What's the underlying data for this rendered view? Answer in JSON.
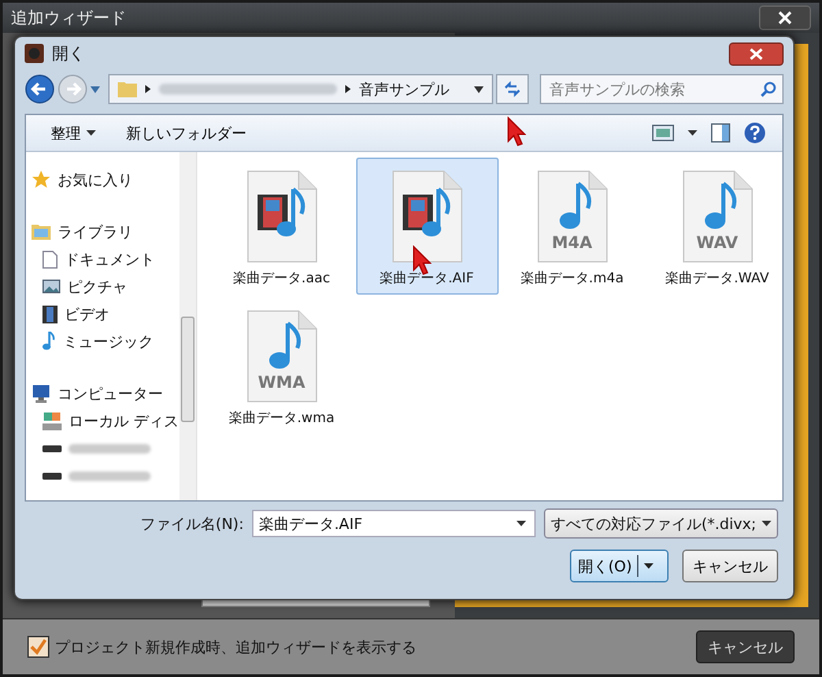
{
  "wizard": {
    "title": "追加ウィザード",
    "show_wizard": {
      "label": "プロジェクト新規作成時、追加ウィザードを表示する",
      "checked": true
    },
    "cancel_button": "キャンセル"
  },
  "dialog": {
    "title": "開く",
    "breadcrumb": [
      "音声サンプル"
    ],
    "search": {
      "placeholder": "音声サンプルの検索"
    },
    "toolbar": {
      "organize": "整理",
      "new_folder": "新しいフォルダー"
    },
    "sidebar": [
      {
        "label": "お気に入り",
        "kind": "favorites"
      },
      {
        "label": "ライブラリ",
        "kind": "library",
        "children": [
          {
            "label": "ドキュメント",
            "kind": "document"
          },
          {
            "label": "ピクチャ",
            "kind": "picture"
          },
          {
            "label": "ビデオ",
            "kind": "video"
          },
          {
            "label": "ミュージック",
            "kind": "music"
          }
        ]
      },
      {
        "label": "コンピューター",
        "kind": "computer",
        "children": [
          {
            "label": "ローカル ディス",
            "kind": "disk"
          },
          {
            "kind": "drive"
          },
          {
            "kind": "drive"
          }
        ]
      }
    ],
    "files": [
      {
        "name": "楽曲データ.aac",
        "kind": "video-audio",
        "selected": false
      },
      {
        "name": "楽曲データ.AIF",
        "kind": "video-audio",
        "selected": true
      },
      {
        "name": "楽曲データ.m4a",
        "kind": "audio",
        "type_label": "M4A",
        "selected": false
      },
      {
        "name": "楽曲データ.WAV",
        "kind": "audio",
        "type_label": "WAV",
        "selected": false
      },
      {
        "name": "楽曲データ.wma",
        "kind": "audio",
        "type_label": "WMA",
        "selected": false
      }
    ],
    "filename": {
      "label": "ファイル名(N):",
      "value": "楽曲データ.AIF"
    },
    "filter": "すべての対応ファイル(*.divx;",
    "open_button": "開く(O)",
    "cancel_button": "キャンセル"
  }
}
